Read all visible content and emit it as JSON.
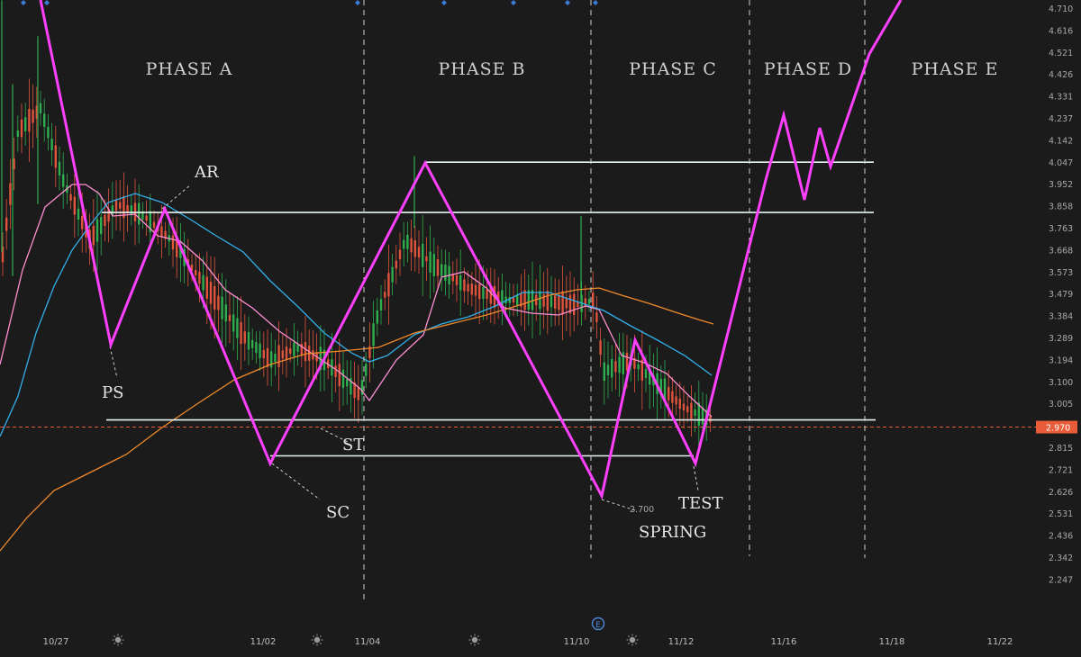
{
  "chart_data": {
    "type": "line",
    "title": "",
    "xlabel": "",
    "ylabel": "",
    "ylim": [
      2.2,
      4.72
    ],
    "y_ticks": [
      "4.710",
      "4.616",
      "4.521",
      "4.426",
      "4.331",
      "4.237",
      "4.142",
      "4.047",
      "3.952",
      "3.858",
      "3.763",
      "3.668",
      "3.573",
      "3.479",
      "3.384",
      "3.289",
      "3.194",
      "3.100",
      "3.005",
      "2.910",
      "2.815",
      "2.721",
      "2.626",
      "2.531",
      "2.436",
      "2.342",
      "2.247"
    ],
    "x_ticks": [
      "10/27",
      "11/02",
      "11/04",
      "11/10",
      "11/12",
      "11/16",
      "11/18",
      "11/22"
    ],
    "current_price": "2.970",
    "phases": [
      "PHASE A",
      "PHASE B",
      "PHASE C",
      "PHASE D",
      "PHASE E"
    ],
    "annotations": [
      "PS",
      "AR",
      "SC",
      "ST",
      "SPRING",
      "TEST",
      "2.700"
    ],
    "levels": [
      4.075,
      3.865,
      3.0,
      2.85
    ],
    "series": [
      {
        "name": "",
        "color": "#ff40ff",
        "points": [
          [
            "10/26",
            4.72
          ],
          [
            "10/28",
            3.33
          ],
          [
            "10/29",
            3.89
          ],
          [
            "11/02",
            2.85
          ],
          [
            "11/05",
            4.07
          ],
          [
            "11/10",
            2.7
          ],
          [
            "11/11",
            3.34
          ],
          [
            "11/12",
            2.85
          ],
          [
            "11/14",
            3.84
          ],
          [
            "11/14",
            4.27
          ],
          [
            "11/15",
            3.94
          ],
          [
            "11/15",
            4.23
          ],
          [
            "11/16",
            4.06
          ],
          [
            "11/17",
            4.47
          ],
          [
            "11/18",
            4.72
          ]
        ]
      },
      {
        "name": "",
        "color": "#ff8fd2"
      },
      {
        "name": "",
        "color": "#33aee8"
      },
      {
        "name": "",
        "color": "#f08a2a"
      }
    ],
    "colors": {
      "up": "#2fae4f",
      "down": "#e0533c",
      "level_line": "#e9f4f4",
      "price_marker": "#e85c3a",
      "background": "#1b1b1b"
    },
    "icons": [
      "sun-icon",
      "diamond-marker-icon",
      "event-e-icon"
    ]
  }
}
